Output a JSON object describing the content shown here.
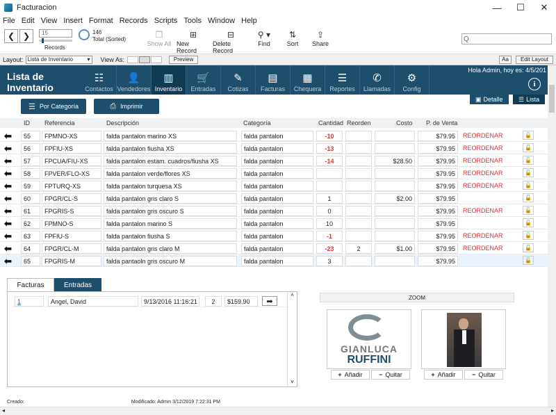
{
  "window": {
    "title": "Facturacion",
    "minimize": "—",
    "maximize": "☐",
    "close": "✕"
  },
  "menu": [
    "File",
    "Edit",
    "View",
    "Insert",
    "Format",
    "Records",
    "Scripts",
    "Tools",
    "Window",
    "Help"
  ],
  "toolbar": {
    "record_number": "15",
    "total": "146",
    "total_sorted": "Total (Sorted)",
    "records_label": "Records",
    "show_all": "Show All",
    "new_record": "New Record",
    "delete_record": "Delete Record",
    "find": "Find",
    "sort": "Sort",
    "share": "Share",
    "search_placeholder": "Q"
  },
  "layoutbar": {
    "layout_label": "Layout:",
    "layout_value": "Lista de Inventario",
    "view_as": "View As:",
    "preview": "Preview",
    "aa": "Aa",
    "edit_layout": "Edit Layout"
  },
  "header": {
    "title_line1": "Lista de",
    "title_line2": "Inventario",
    "greeting": "Hola Admin, hoy es: 4/5/201",
    "info": "i",
    "nav": [
      {
        "label": "Contactos",
        "icon": "☷"
      },
      {
        "label": "Vendedores",
        "icon": "👤"
      },
      {
        "label": "Inventario",
        "icon": "▥"
      },
      {
        "label": "Entradas",
        "icon": "🛒"
      },
      {
        "label": "Cotizas",
        "icon": "✎"
      },
      {
        "label": "Facturas",
        "icon": "▤"
      },
      {
        "label": "Chequera",
        "icon": "▦"
      },
      {
        "label": "Reportes",
        "icon": "☰"
      },
      {
        "label": "Llamadas",
        "icon": "✆"
      },
      {
        "label": "Config",
        "icon": "⚙"
      }
    ]
  },
  "subbar": {
    "por_categoria": "Por Categoría",
    "imprimir": "Imprimir",
    "detalle": "Detalle",
    "lista": "Lista"
  },
  "table": {
    "headers": {
      "id": "ID",
      "referencia": "Referencia",
      "descripcion": "Descripción",
      "categoria": "Categoría",
      "cantidad": "Cantidad",
      "reorden": "Reorden",
      "costo": "Costo",
      "precio": "P. de Venta"
    },
    "rows": [
      {
        "id": "55",
        "ref": "FPMNO-XS",
        "desc": "falda pantalon marino XS",
        "cat": "falda pantalon",
        "qty": "-10",
        "reorden": "",
        "costo": "",
        "precio": "$79.95",
        "flag": "REORDENAR"
      },
      {
        "id": "56",
        "ref": "FPFIU-XS",
        "desc": "falda pantalon fiusha XS",
        "cat": "falda pantalon",
        "qty": "-13",
        "reorden": "",
        "costo": "",
        "precio": "$79.95",
        "flag": "REORDENAR"
      },
      {
        "id": "57",
        "ref": "FPCUA/FIU-XS",
        "desc": "falda pantalon estam. cuadros/fiusha XS",
        "cat": "falda pantalon",
        "qty": "-14",
        "reorden": "",
        "costo": "$28.50",
        "precio": "$79.95",
        "flag": "REORDENAR"
      },
      {
        "id": "58",
        "ref": "FPVER/FLO-XS",
        "desc": "falda pantalon verde/flores XS",
        "cat": "falda pantalon",
        "qty": "",
        "reorden": "",
        "costo": "",
        "precio": "$79.95",
        "flag": "REORDENAR"
      },
      {
        "id": "59",
        "ref": "FPTURQ-XS",
        "desc": "falda pantalon turquesa XS",
        "cat": "falda pantalon",
        "qty": "",
        "reorden": "",
        "costo": "",
        "precio": "$79.95",
        "flag": "REORDENAR"
      },
      {
        "id": "60",
        "ref": "FPGR/CL-S",
        "desc": "falda pantalon gris claro S",
        "cat": "falda pantalon",
        "qty": "1",
        "reorden": "",
        "costo": "$2.00",
        "precio": "$79.95",
        "flag": ""
      },
      {
        "id": "61",
        "ref": "FPGRIS-S",
        "desc": "falda pantalon gris oscuro S",
        "cat": "falda pantalon",
        "qty": "0",
        "reorden": "",
        "costo": "",
        "precio": "$79.95",
        "flag": "REORDENAR"
      },
      {
        "id": "62",
        "ref": "FPMNO-S",
        "desc": "falda pantalon marino S",
        "cat": "falda pantalon",
        "qty": "10",
        "reorden": "",
        "costo": "",
        "precio": "$79.95",
        "flag": ""
      },
      {
        "id": "63",
        "ref": "FPFIU-S",
        "desc": "falda pantalon fiusha S",
        "cat": "falda pantalon",
        "qty": "-1",
        "reorden": "",
        "costo": "",
        "precio": "$79.95",
        "flag": "REORDENAR"
      },
      {
        "id": "64",
        "ref": "FPGR/CL-M",
        "desc": "falda pantalon gris claro M",
        "cat": "falda pantalon",
        "qty": "-23",
        "reorden": "2",
        "costo": "$1.00",
        "precio": "$79.95",
        "flag": "REORDENAR"
      },
      {
        "id": "65",
        "ref": "FPGRIS-M",
        "desc": "falda pantaoln gris oscuro M",
        "cat": "falda pantalon",
        "qty": "3",
        "reorden": "",
        "costo": "",
        "precio": "$79.95",
        "flag": ""
      }
    ]
  },
  "lower": {
    "tab_facturas": "Facturas",
    "tab_entradas": "Entradas",
    "factura": {
      "num": "1",
      "cliente": "Angel, David",
      "fecha": "9/13/2016 11:16:21",
      "qty": "2",
      "total": "$159.90"
    },
    "zoom": "ZOOM",
    "logo_line1": "GIANLUCA",
    "logo_line2": "RUFFINI",
    "anadir": "Añadir",
    "quitar": "Quitar"
  },
  "status": {
    "creado": "Creado:",
    "modificado": "Modificado: Admin  3/12/2019 7:22:31 PM"
  },
  "colors": {
    "header": "#1d4e6b",
    "reorder": "#e03030"
  }
}
